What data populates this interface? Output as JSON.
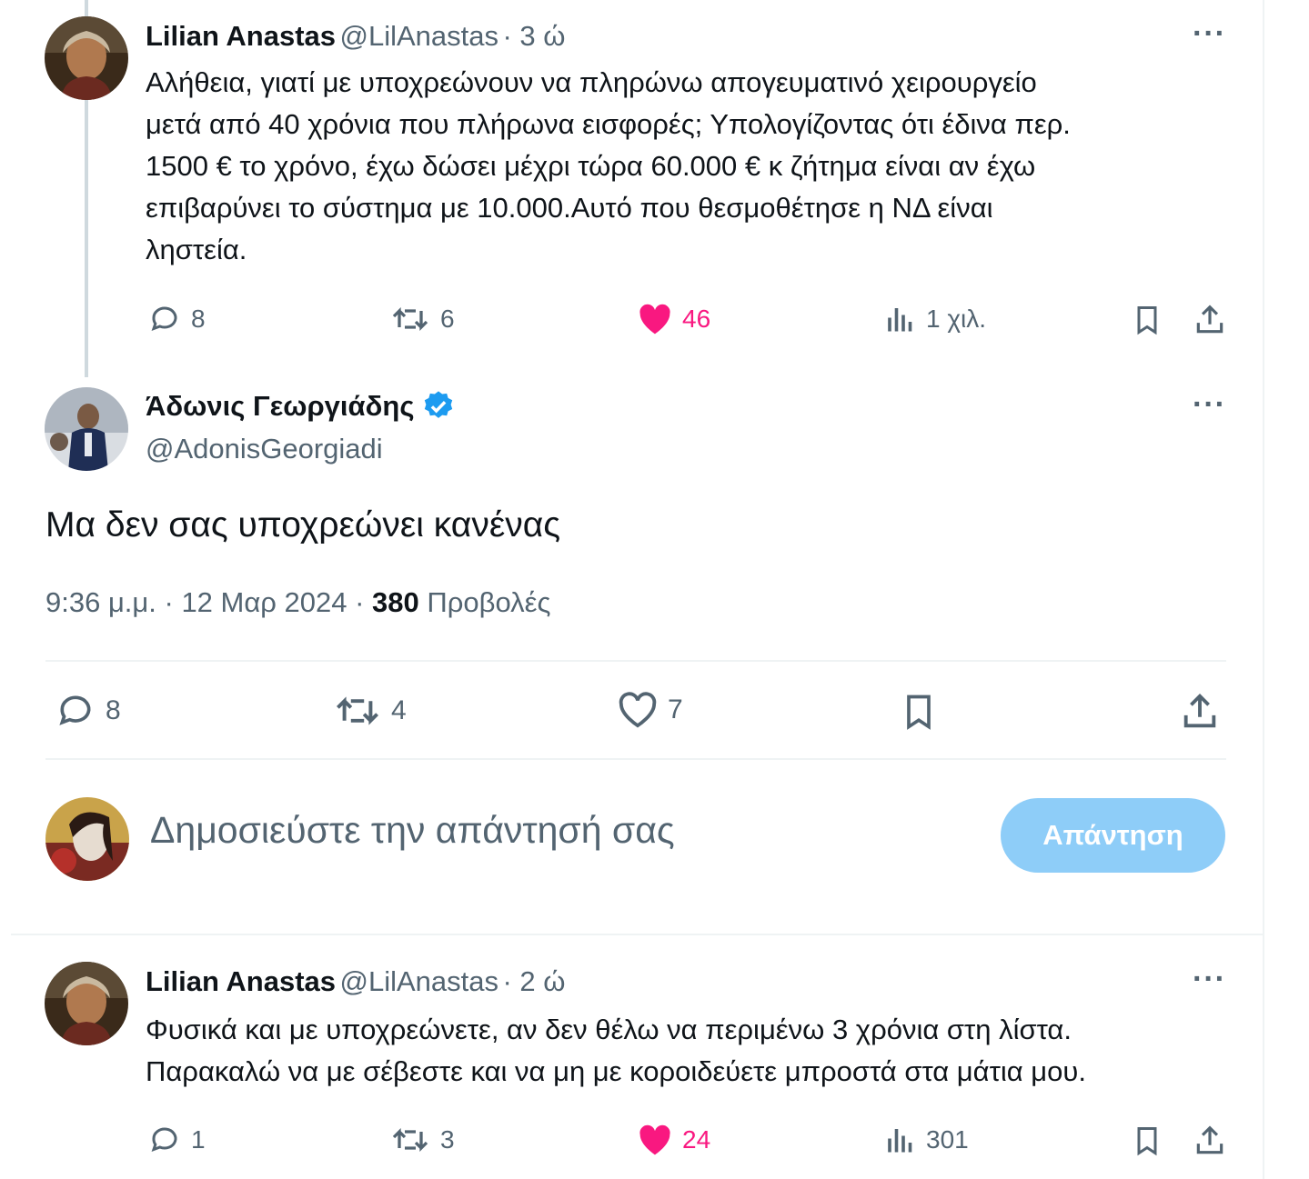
{
  "tweet1": {
    "name": "Lilian Anastas",
    "handle": "@LilAnastas",
    "time": "· 3 ώ",
    "text_lines": [
      "Αλήθεια, γιατί με υποχρεώνουν να πληρώνω απογευματινό χειρουργείο",
      "μετά από 40 χρόνια που πλήρωνα εισφορές; Υπολογίζοντας ότι έδινα περ.",
      "1500 € το χρόνο, έχω δώσει μέχρι τώρα 60.000 € κ ζήτημα είναι αν έχω",
      "επιβαρύνει το σύστημα με 10.000.Αυτό που θεσμοθέτησε η ΝΔ είναι",
      "ληστεία."
    ],
    "replies": "8",
    "retweets": "6",
    "likes": "46",
    "views": "1 χιλ."
  },
  "main_tweet": {
    "name": "Άδωνις Γεωργιάδης",
    "handle": "@AdonisGeorgiadi",
    "text": "Μα δεν σας υποχρεώνει κανένας",
    "timestamp": "9:36 μ.μ. · 12 Μαρ 2024 · ",
    "views_count": "380",
    "views_label": "Προβολές",
    "replies": "8",
    "retweets": "4",
    "likes": "7"
  },
  "composer": {
    "placeholder": "Δημοσιεύστε την απάντησή σας",
    "button_label": "Απάντηση"
  },
  "tweet3": {
    "name": "Lilian Anastas",
    "handle": "@LilAnastas",
    "time": "· 2 ώ",
    "text_lines": [
      "Φυσικά και με υποχρεώνετε, αν δεν θέλω να περιμένω 3 χρόνια στη λίστα.",
      "Παρακαλώ να με σέβεστε και να μη με κοροιδεύετε μπροστά στα μάτια μου."
    ],
    "replies": "1",
    "retweets": "3",
    "likes": "24",
    "views": "301"
  },
  "more_label": "···",
  "colors": {
    "like": "#f91880",
    "verified": "#1d9bf0",
    "reply_button": "#8ecdf8",
    "secondary": "#536471"
  }
}
